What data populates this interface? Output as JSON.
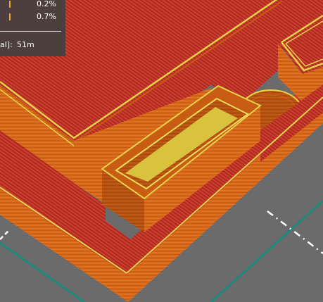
{
  "legend": {
    "rows": [
      {
        "percent": "0.2%",
        "color": "#e8a33a"
      },
      {
        "percent": "0.7%",
        "color": "#e8a33a"
      }
    ],
    "time_label": "al]:",
    "time_value": "51m"
  },
  "colors": {
    "infill": "#b32a1f",
    "infill_stripe": "#d2493a",
    "perimeter": "#c85c12",
    "perimeter_stripe": "#e87d28",
    "outer_perimeter": "#e8d24a",
    "print_bed": "#6b6b6b",
    "bed_edge": "#1d8a7a",
    "axis_line": "#ffffff"
  }
}
